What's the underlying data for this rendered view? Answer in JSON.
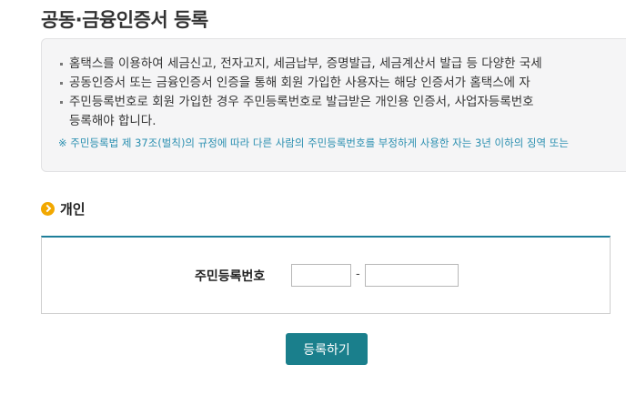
{
  "page": {
    "title": "공동·금융인증서 등록"
  },
  "notice": {
    "items": [
      {
        "lines": [
          "홈택스를 이용하여 세금신고, 전자고지, 세금납부, 증명발급, 세금계산서 발급 등 다양한 국세"
        ]
      },
      {
        "lines": [
          "공동인증서 또는 금융인증서 인증을 통해 회원 가입한 사용자는 해당 인증서가 홈택스에 자"
        ]
      },
      {
        "lines": [
          "주민등록번호로 회원 가입한 경우 주민등록번호로 발급받은 개인용 인증서, 사업자등록번호",
          "등록해야 합니다."
        ]
      }
    ],
    "warning": "※ 주민등록법 제 37조(벌칙)의 규정에 따라 다른 사람의 주민등록번호를 부정하게 사용한 자는 3년 이하의 징역 또는"
  },
  "section": {
    "title": "개인"
  },
  "form": {
    "rrn_label": "주민등록번호",
    "rrn_front_value": "",
    "rrn_separator": "-",
    "rrn_back_value": ""
  },
  "actions": {
    "submit_label": "등록하기"
  },
  "colors": {
    "accent": "#1a7f8c",
    "section_icon": "#f2a800",
    "warning_text": "#2a8fb0"
  }
}
